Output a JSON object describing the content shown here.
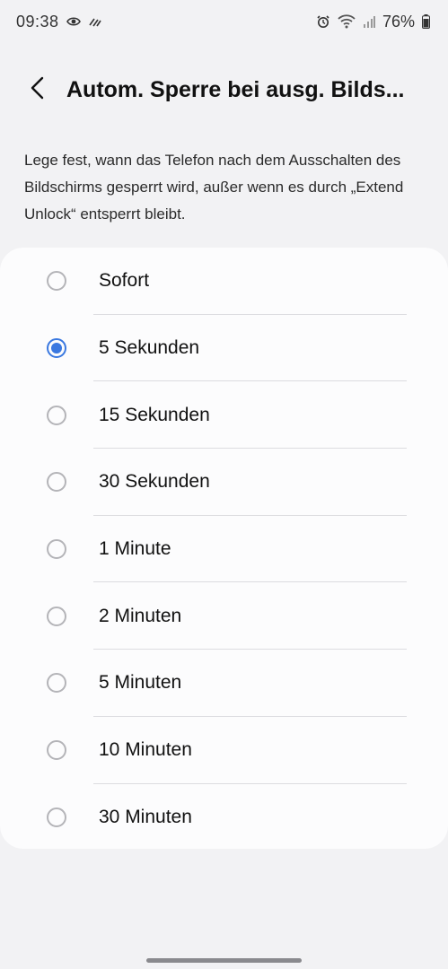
{
  "status_bar": {
    "time": "09:38",
    "battery": "76%",
    "icons": [
      "eye-icon",
      "sync-icon",
      "alarm-icon",
      "wifi-icon",
      "signal-icon",
      "battery-icon"
    ]
  },
  "header": {
    "title": "Autom. Sperre bei ausg. Bilds..."
  },
  "description": "Lege fest, wann das Telefon nach dem Ausschalten des Bildschirms gesperrt wird, außer wenn es durch „Extend Unlock“ entsperrt bleibt.",
  "options": [
    {
      "label": "Sofort",
      "selected": false
    },
    {
      "label": "5 Sekunden",
      "selected": true
    },
    {
      "label": "15 Sekunden",
      "selected": false
    },
    {
      "label": "30 Sekunden",
      "selected": false
    },
    {
      "label": "1 Minute",
      "selected": false
    },
    {
      "label": "2 Minuten",
      "selected": false
    },
    {
      "label": "5 Minuten",
      "selected": false
    },
    {
      "label": "10 Minuten",
      "selected": false
    },
    {
      "label": "30 Minuten",
      "selected": false
    }
  ],
  "colors": {
    "accent": "#3a78e0",
    "background": "#f2f2f4",
    "card": "#fcfcfd"
  }
}
